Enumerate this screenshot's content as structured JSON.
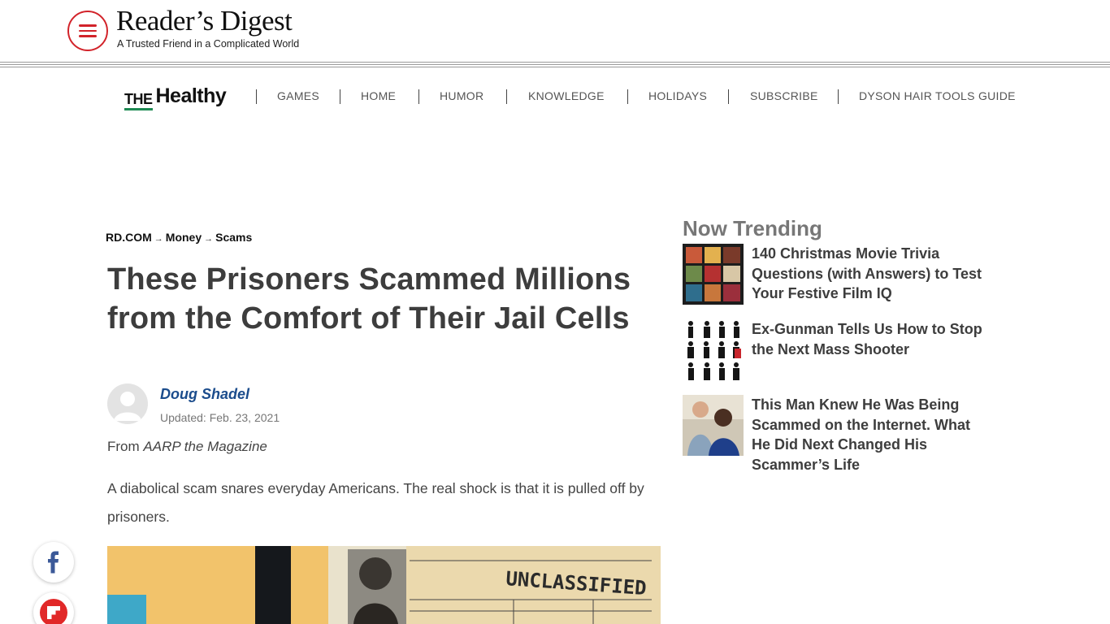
{
  "header": {
    "logo_title": "Reader’s Digest",
    "logo_tagline": "A Trusted Friend in a Complicated World",
    "brand_color": "#d2232a"
  },
  "subnav": {
    "brand_the": "THE",
    "brand_word": "Healthy",
    "items": [
      "GAMES",
      "HOME",
      "HUMOR",
      "KNOWLEDGE",
      "HOLIDAYS",
      "SUBSCRIBE",
      "DYSON HAIR TOOLS GUIDE"
    ]
  },
  "breadcrumb": {
    "items": [
      "RD.COM",
      "Money",
      "Scams"
    ],
    "separator": "→"
  },
  "article": {
    "title": "These Prisoners Scammed Millions from the Comfort of Their Jail Cells",
    "author": "Doug Shadel",
    "updated": "Updated: Feb. 23, 2021",
    "from_prefix": "From",
    "from_publication": "AARP the Magazine",
    "dek": "A diabolical scam snares everyday Americans. The real shock is that it is pulled off by prisoners.",
    "hero_stamp": "UNCLASSIFIED"
  },
  "social": {
    "items": [
      {
        "icon": "facebook-icon",
        "color": "#3b5998"
      },
      {
        "icon": "flipboard-icon",
        "color": "#e12828"
      }
    ]
  },
  "trending": {
    "heading": "Now Trending",
    "items": [
      {
        "title": "140 Christmas Movie Trivia Questions (with Answers) to Test Your Festive Film IQ"
      },
      {
        "title": "Ex-Gunman Tells Us How to Stop the Next Mass Shooter"
      },
      {
        "title": "This Man Knew He Was Being Scammed on the Internet. What He Did Next Changed His Scammer’s Life"
      }
    ]
  }
}
